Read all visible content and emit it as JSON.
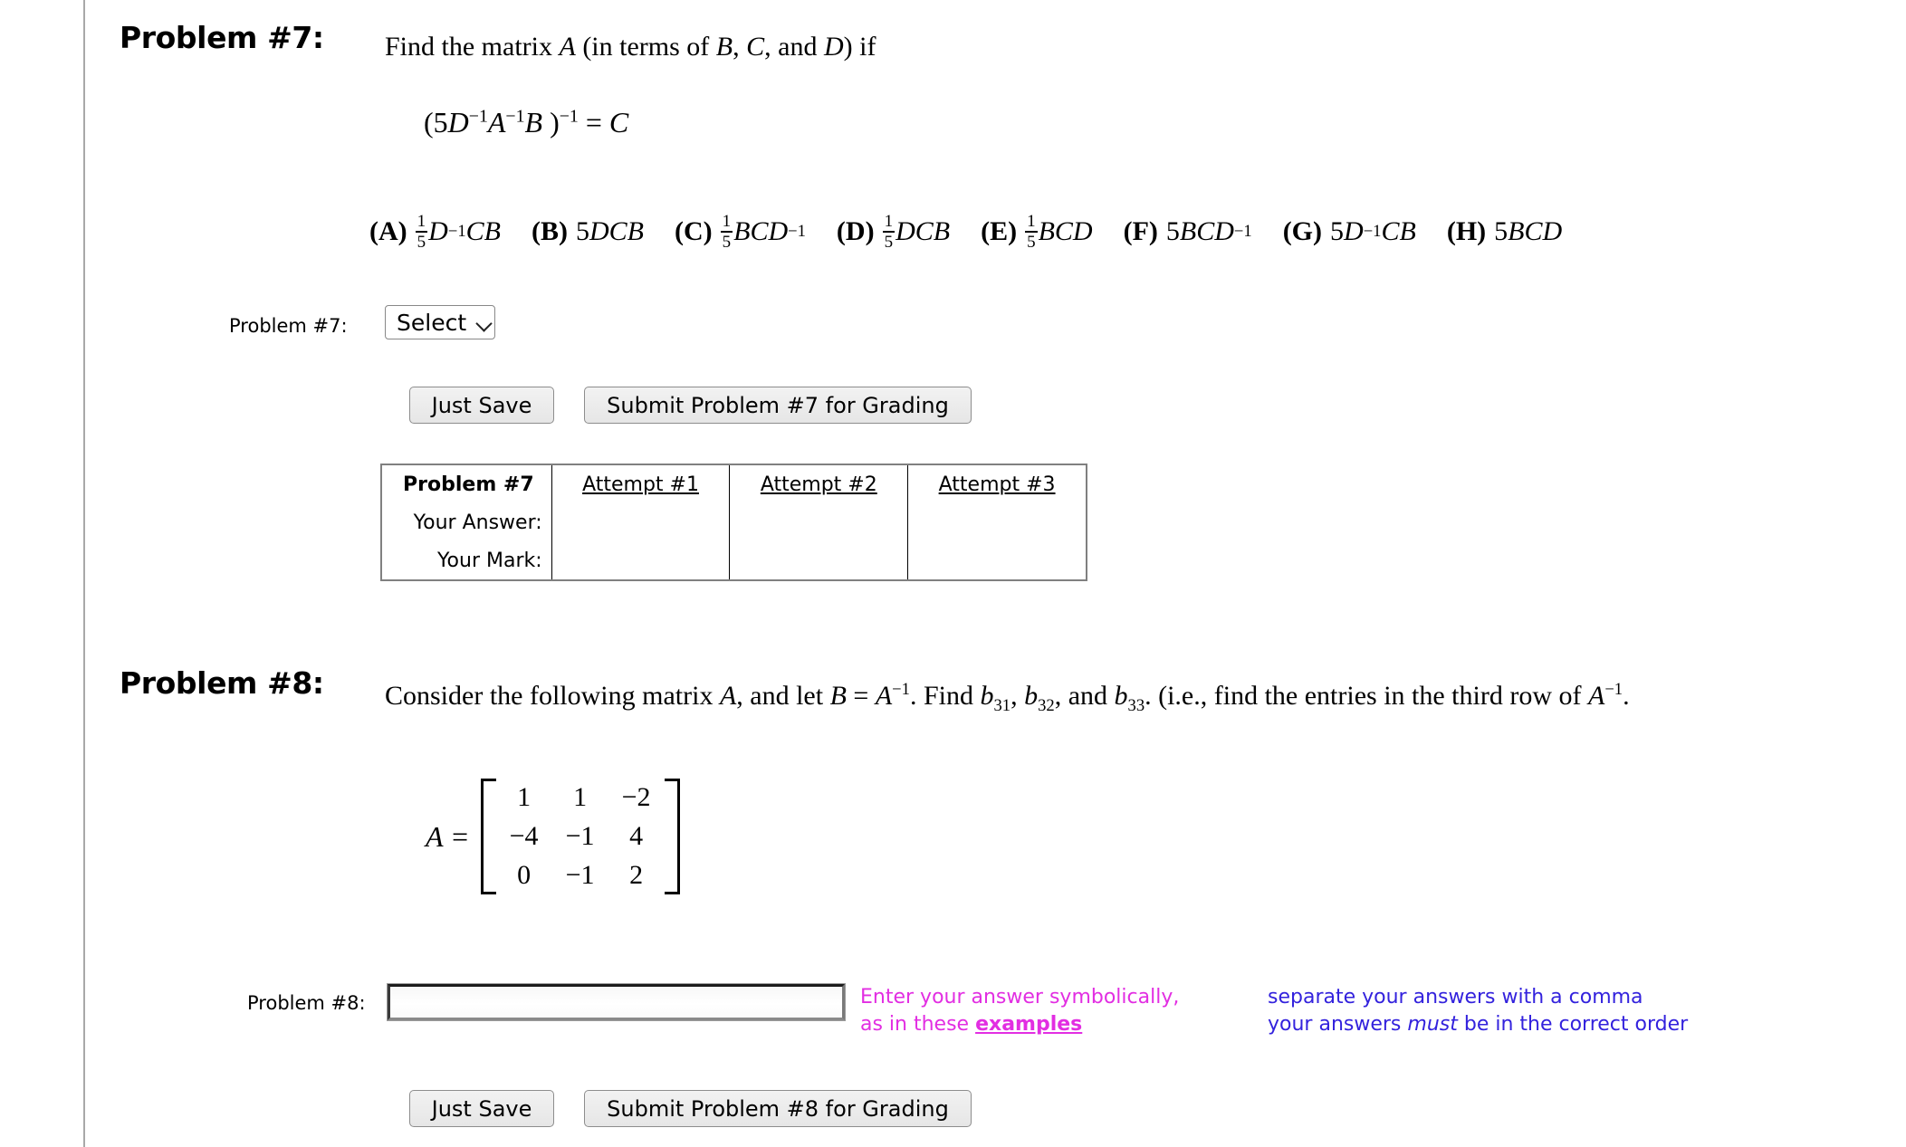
{
  "page": {
    "background": "#ffffff",
    "rule_color": "#a8a8a8",
    "pink": "#e22ee2",
    "blue": "#3322dd"
  },
  "problem7": {
    "heading": "Problem #7:",
    "prompt_pre": "Find the matrix ",
    "prompt_var": "A",
    "prompt_mid": " (in terms of ",
    "prompt_b": "B",
    "prompt_sep1": ", ",
    "prompt_c": "C",
    "prompt_sep2": ", and ",
    "prompt_d": "D",
    "prompt_post": ") if",
    "equation": "(5D^-1 A^-1 B )^-1 = C",
    "equation_parts": {
      "open": "(5",
      "d": "D",
      "d_exp": "−1",
      "a": "A",
      "a_exp": "−1",
      "b": "B",
      "close": " )",
      "close_exp": "−1",
      "equals": " = ",
      "c": "C"
    },
    "choices": [
      {
        "tag": "(A)",
        "coef": "",
        "frac": "1/5",
        "expr": "D",
        "exp1": "−1",
        "tail": "CB"
      },
      {
        "tag": "(B)",
        "coef": "5",
        "frac": "",
        "expr": "DCB",
        "exp1": "",
        "tail": ""
      },
      {
        "tag": "(C)",
        "coef": "",
        "frac": "1/5",
        "expr": "BCD",
        "exp1": "−1",
        "tail": "",
        "exp_at_end": true
      },
      {
        "tag": "(D)",
        "coef": "",
        "frac": "1/5",
        "expr": "DCB",
        "exp1": "",
        "tail": ""
      },
      {
        "tag": "(E)",
        "coef": "",
        "frac": "1/5",
        "expr": "BCD",
        "exp1": "",
        "tail": ""
      },
      {
        "tag": "(F)",
        "coef": "5",
        "frac": "",
        "expr": "BCD",
        "exp1": "−1",
        "tail": "",
        "exp_at_end": true
      },
      {
        "tag": "(G)",
        "coef": "5",
        "frac": "",
        "expr": "D",
        "exp1": "−1",
        "tail": "CB"
      },
      {
        "tag": "(H)",
        "coef": "5",
        "frac": "",
        "expr": "BCD",
        "exp1": "",
        "tail": ""
      }
    ],
    "choice_labels_flat": [
      "(A)",
      "(B)",
      "(C)",
      "(D)",
      "(E)",
      "(F)",
      "(G)",
      "(H)"
    ],
    "answer_row_label": "Problem #7:",
    "select_value": "Select",
    "select_options": [
      "Select",
      "(A)",
      "(B)",
      "(C)",
      "(D)",
      "(E)",
      "(F)",
      "(G)",
      "(H)"
    ],
    "just_save_label": "Just Save",
    "submit_label": "Submit Problem #7 for Grading",
    "table": {
      "corner": "Problem #7",
      "row_labels": [
        "Your Answer:",
        "Your Mark:"
      ],
      "columns": [
        "Attempt #1",
        "Attempt #2",
        "Attempt #3"
      ],
      "cells": [
        [
          "",
          "",
          ""
        ],
        [
          "",
          "",
          ""
        ]
      ]
    }
  },
  "problem8": {
    "heading": "Problem #8:",
    "prompt_1": "Consider the following matrix ",
    "prompt_a": "A",
    "prompt_2": ", and let ",
    "prompt_b": "B",
    "prompt_3": " = ",
    "prompt_ainv": "A",
    "prompt_ainv_exp": "−1",
    "prompt_4": ". Find ",
    "b31": "b",
    "b31_sub": "31",
    "prompt_5": ", ",
    "b32": "b",
    "b32_sub": "32",
    "prompt_6": ", and ",
    "b33": "b",
    "b33_sub": "33",
    "prompt_7": ". (i.e., find the entries in the third row of ",
    "prompt_8_a": "A",
    "prompt_8_exp": "−1",
    "prompt_9": ".",
    "matrix_lhs": "A =",
    "matrix": [
      [
        "1",
        "1",
        "−2"
      ],
      [
        "−4",
        "−1",
        "4"
      ],
      [
        "0",
        "−1",
        "2"
      ]
    ],
    "answer_row_label": "Problem #8:",
    "answer_value": "",
    "answer_placeholder": "",
    "hint_pink_line1": "Enter your answer symbolically,",
    "hint_pink_line2_pre": "as in these ",
    "hint_pink_link": "examples",
    "hint_blue_line1": "separate your answers with a comma",
    "hint_blue_line2_pre": "your answers ",
    "hint_blue_line2_em": "must",
    "hint_blue_line2_post": " be in the correct order",
    "just_save_label": "Just Save",
    "submit_label": "Submit Problem #8 for Grading"
  }
}
